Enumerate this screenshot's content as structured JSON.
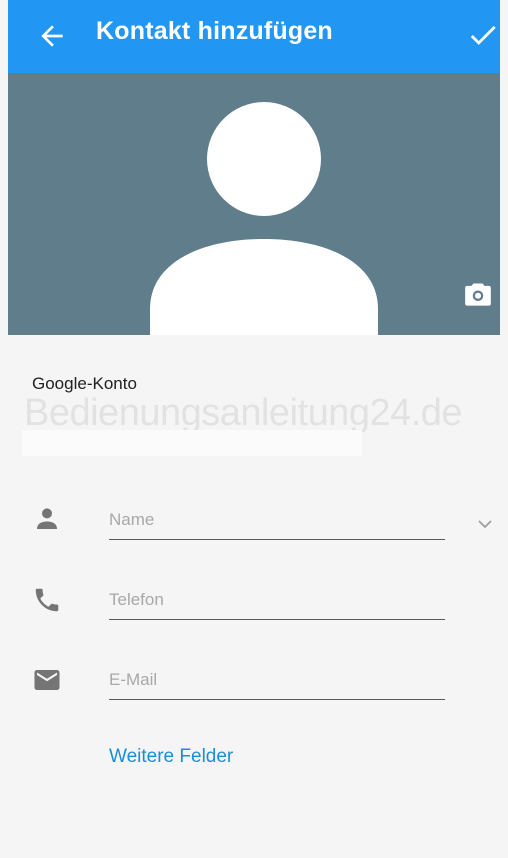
{
  "appbar": {
    "title": "Kontakt hinzufügen",
    "back_icon": "arrow-left-icon",
    "done_icon": "checkmark-icon",
    "color": "#2196f3"
  },
  "photo": {
    "background": "#607d8b",
    "avatar_icon": "person-silhouette-icon",
    "camera_icon": "camera-icon"
  },
  "account": {
    "label": "Google-Konto",
    "watermark": "Bedienungsanleitung24.de"
  },
  "fields": {
    "name_placeholder": "Name",
    "phone_placeholder": "Telefon",
    "email_placeholder": "E-Mail",
    "name_icon": "person-icon",
    "phone_icon": "phone-icon",
    "email_icon": "email-icon",
    "expand_icon": "chevron-down-icon"
  },
  "more_fields_label": "Weitere Felder"
}
